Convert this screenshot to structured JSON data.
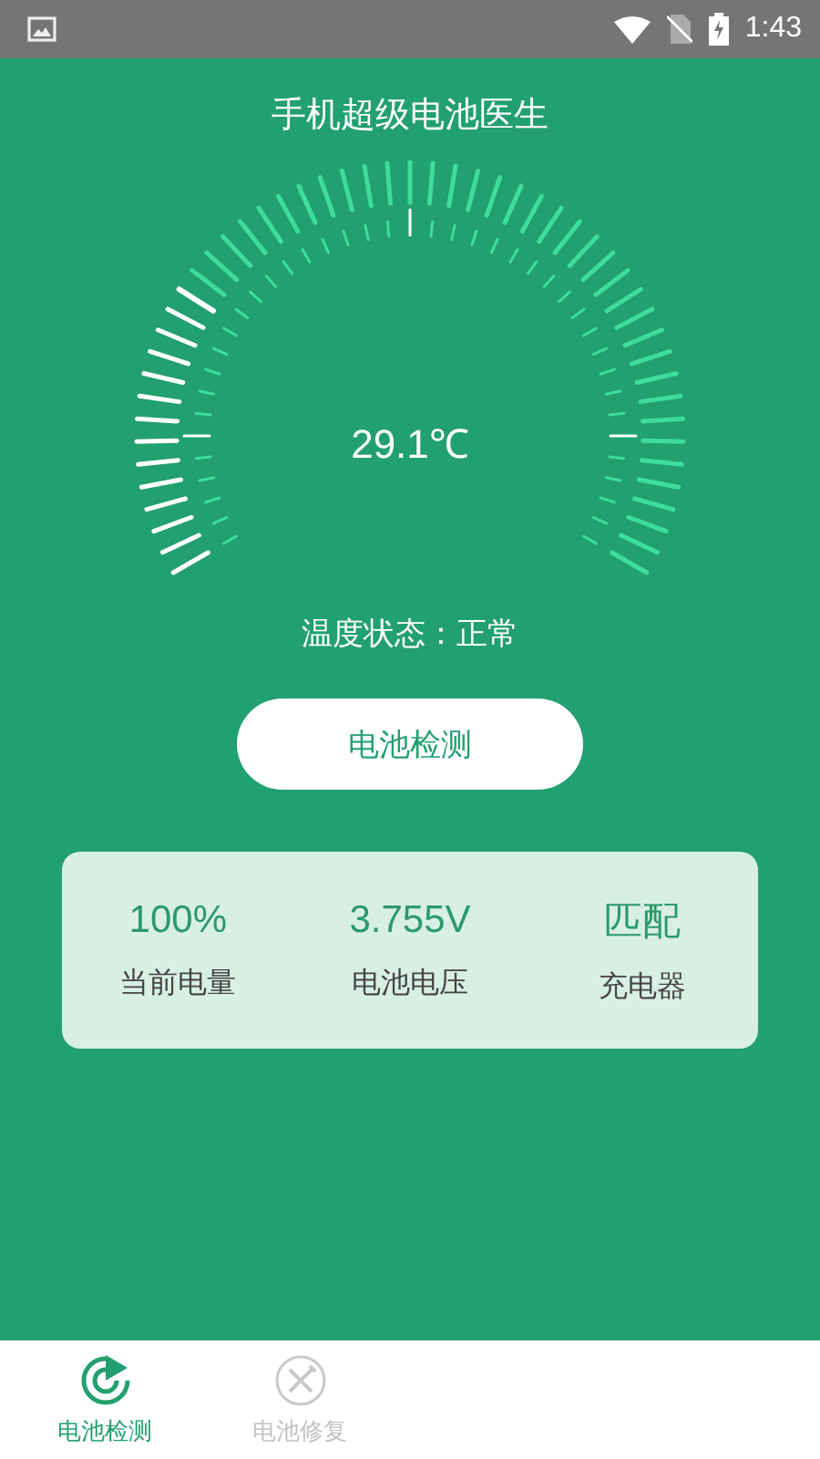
{
  "status_bar": {
    "time": "1:43"
  },
  "title": "手机超级电池医生",
  "gauge": {
    "reading": "29.1℃"
  },
  "temperature_status": "温度状态：正常",
  "check_button": "电池检测",
  "stats": [
    {
      "value": "100%",
      "label": "当前电量"
    },
    {
      "value": "3.755V",
      "label": "电池电压"
    },
    {
      "value": "匹配",
      "label": "充电器"
    }
  ],
  "tabs": [
    {
      "label": "电池检测",
      "kind": "scan",
      "selected": true
    },
    {
      "label": "电池修复",
      "kind": "repair",
      "selected": false
    }
  ]
}
